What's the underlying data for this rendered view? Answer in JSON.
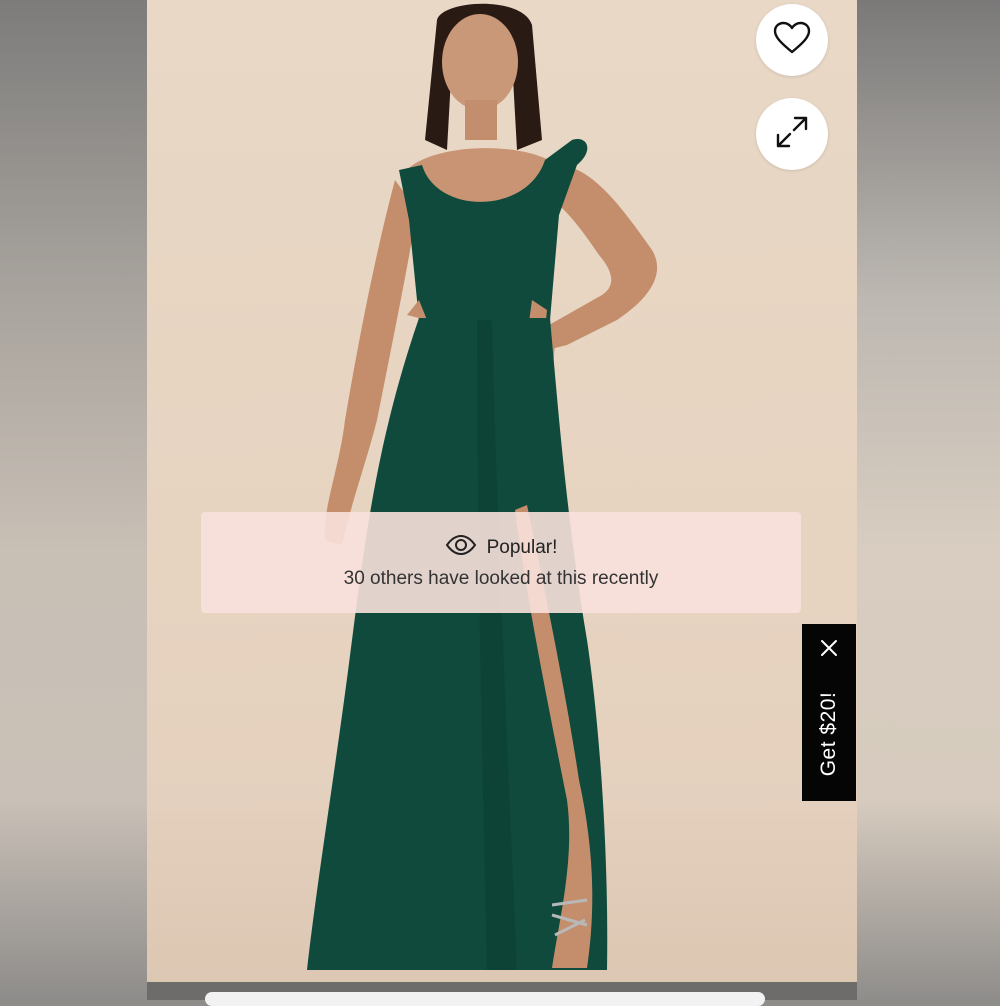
{
  "product": {
    "image_alt": "Model wearing emerald green maxi dress with ruffle straps and side cutouts",
    "dress_color": "#0f4a3c"
  },
  "actions": {
    "wishlist_icon": "heart-icon",
    "expand_icon": "expand-arrows-icon"
  },
  "popular_banner": {
    "icon": "eye-icon",
    "title": "Popular!",
    "subtitle": "30 others have looked at this recently"
  },
  "promo": {
    "label": "Get $20!",
    "close_icon": "close-icon"
  }
}
